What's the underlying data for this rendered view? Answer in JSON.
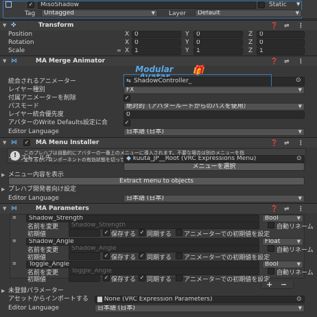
{
  "gameobject": {
    "enabled": "✓",
    "name": "MisoShadow",
    "static_label": "Static",
    "tag_label": "Tag",
    "tag_value": "Untagged",
    "layer_label": "Layer",
    "layer_value": "Default"
  },
  "transform": {
    "title": "Transform",
    "rows": [
      {
        "label": "Position",
        "x": "0",
        "y": "0",
        "z": "0"
      },
      {
        "label": "Rotation",
        "x": "0",
        "y": "0",
        "z": "0"
      },
      {
        "label": "Scale",
        "x": "1",
        "y": "1",
        "z": "1"
      }
    ],
    "axis_x": "X",
    "axis_y": "Y",
    "axis_z": "Z"
  },
  "merge_animator": {
    "title": "MA Merge Animator",
    "logo_line1": "Modular",
    "logo_line2": "Avatar",
    "fields": [
      {
        "label": "統合されるアニメーター",
        "value": "ShadowController_"
      },
      {
        "label": "レイヤー種別",
        "value": "FX"
      },
      {
        "label": "付属アニメーターを削除",
        "value": "✓"
      },
      {
        "label": "パスモード",
        "value": "絶対的（アバタールートからのパスを使用）"
      },
      {
        "label": "レイヤー統合優先度",
        "value": "0"
      },
      {
        "label": "アバターのWrite Defaults設定に合",
        "value": "✓"
      },
      {
        "label": "Editor Language",
        "value": "日本語 (日本)"
      }
    ]
  },
  "menu_installer": {
    "title": "MA Menu Installer",
    "info_line1": "このプレハブは自動的にアバターの一番上のメニューに導入されます。不要な場合は別のメニューを指",
    "info_line2": "定するか、コンポーネントの有効状態を切ってください。",
    "install_label": "インストール先",
    "install_value": "kuuta_JP__Root (VRC Expressions Menu)",
    "select_menu": "メニューを選択",
    "show_contents": "メニュー内容を表示",
    "extract_button": "Extract menu to objects",
    "prefab_dev": "プレハブ開発者向け設定",
    "lang_label": "Editor Language",
    "lang_value": "日本語 (日本)"
  },
  "parameters": {
    "title": "MA Parameters",
    "rename_label": "名前を変更",
    "init_label": "初期値",
    "save_label": "保存する",
    "sync_label": "同期する",
    "anim_init_label": "アニメーターでの初期値を設定",
    "auto_rename_label": "自動リネーム",
    "items": [
      {
        "name": "Shadow_Strength",
        "type": "Bool",
        "rename": "Shadow_Strength",
        "init": ""
      },
      {
        "name": "Shadow_Angle",
        "type": "Float",
        "rename": "Shadow_Angle",
        "init": ""
      },
      {
        "name": "Toggle_Angle",
        "type": "Bool",
        "rename": "Toggle_Angle",
        "init": ""
      }
    ],
    "add_button": "+",
    "remove_button": "−",
    "unregistered": "未登録パラメーター",
    "import_label": "アセットからインポートする",
    "import_value": "None (VRC Expression Parameters)",
    "lang_label": "Editor Language",
    "lang_value": "日本語 (日本)"
  },
  "colors": {
    "background": "#383838",
    "header": "#3e3e3e",
    "field": "#2a2a2a",
    "highlight": "#3a79bb",
    "logo": "#5aa8e8"
  }
}
